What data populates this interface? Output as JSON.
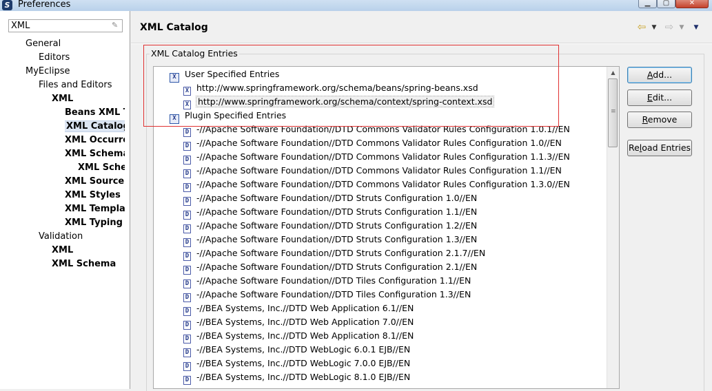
{
  "window": {
    "title": "Preferences",
    "app_icon_letter": "S"
  },
  "filter": {
    "value": "XML"
  },
  "tree": [
    {
      "label": "General",
      "indent": 1,
      "bold": false,
      "selected": false
    },
    {
      "label": "Editors",
      "indent": 2,
      "bold": false,
      "selected": false
    },
    {
      "label": "MyEclipse",
      "indent": 1,
      "bold": false,
      "selected": false
    },
    {
      "label": "Files and Editors",
      "indent": 2,
      "bold": false,
      "selected": false
    },
    {
      "label": "XML",
      "indent": 3,
      "bold": true,
      "selected": false
    },
    {
      "label": "Beans XML Te",
      "indent": 4,
      "bold": true,
      "selected": false
    },
    {
      "label": "XML Catalog",
      "indent": 4,
      "bold": true,
      "selected": true
    },
    {
      "label": "XML Occurren",
      "indent": 4,
      "bold": true,
      "selected": false
    },
    {
      "label": "XML Schema",
      "indent": 4,
      "bold": true,
      "selected": false
    },
    {
      "label": "XML Schen",
      "indent": 5,
      "bold": true,
      "selected": false
    },
    {
      "label": "XML Source",
      "indent": 4,
      "bold": true,
      "selected": false
    },
    {
      "label": "XML Styles",
      "indent": 4,
      "bold": true,
      "selected": false
    },
    {
      "label": "XML Template",
      "indent": 4,
      "bold": true,
      "selected": false
    },
    {
      "label": "XML Typing",
      "indent": 4,
      "bold": true,
      "selected": false
    },
    {
      "label": "Validation",
      "indent": 2,
      "bold": false,
      "selected": false
    },
    {
      "label": "XML",
      "indent": 3,
      "bold": true,
      "selected": false
    },
    {
      "label": "XML Schema",
      "indent": 3,
      "bold": true,
      "selected": false
    }
  ],
  "page": {
    "title": "XML Catalog",
    "group_label": "XML Catalog Entries"
  },
  "entries": [
    {
      "label": "User Specified Entries",
      "level": 0,
      "kind": "category",
      "icon": "X",
      "selected": false
    },
    {
      "label": "http://www.springframework.org/schema/beans/spring-beans.xsd",
      "level": 1,
      "kind": "xsd",
      "icon": "X",
      "selected": false
    },
    {
      "label": "http://www.springframework.org/schema/context/spring-context.xsd",
      "level": 1,
      "kind": "xsd",
      "icon": "X",
      "selected": true
    },
    {
      "label": "Plugin Specified Entries",
      "level": 0,
      "kind": "category",
      "icon": "X",
      "selected": false
    },
    {
      "label": "-//Apache Software Foundation//DTD Commons Validator Rules Configuration 1.0.1//EN",
      "level": 1,
      "kind": "dtd",
      "icon": "D",
      "selected": false
    },
    {
      "label": "-//Apache Software Foundation//DTD Commons Validator Rules Configuration 1.0//EN",
      "level": 1,
      "kind": "dtd",
      "icon": "D",
      "selected": false
    },
    {
      "label": "-//Apache Software Foundation//DTD Commons Validator Rules Configuration 1.1.3//EN",
      "level": 1,
      "kind": "dtd",
      "icon": "D",
      "selected": false
    },
    {
      "label": "-//Apache Software Foundation//DTD Commons Validator Rules Configuration 1.1//EN",
      "level": 1,
      "kind": "dtd",
      "icon": "D",
      "selected": false
    },
    {
      "label": "-//Apache Software Foundation//DTD Commons Validator Rules Configuration 1.3.0//EN",
      "level": 1,
      "kind": "dtd",
      "icon": "D",
      "selected": false
    },
    {
      "label": "-//Apache Software Foundation//DTD Struts Configuration 1.0//EN",
      "level": 1,
      "kind": "dtd",
      "icon": "D",
      "selected": false
    },
    {
      "label": "-//Apache Software Foundation//DTD Struts Configuration 1.1//EN",
      "level": 1,
      "kind": "dtd",
      "icon": "D",
      "selected": false
    },
    {
      "label": "-//Apache Software Foundation//DTD Struts Configuration 1.2//EN",
      "level": 1,
      "kind": "dtd",
      "icon": "D",
      "selected": false
    },
    {
      "label": "-//Apache Software Foundation//DTD Struts Configuration 1.3//EN",
      "level": 1,
      "kind": "dtd",
      "icon": "D",
      "selected": false
    },
    {
      "label": "-//Apache Software Foundation//DTD Struts Configuration 2.1.7//EN",
      "level": 1,
      "kind": "dtd",
      "icon": "D",
      "selected": false
    },
    {
      "label": "-//Apache Software Foundation//DTD Struts Configuration 2.1//EN",
      "level": 1,
      "kind": "dtd",
      "icon": "D",
      "selected": false
    },
    {
      "label": "-//Apache Software Foundation//DTD Tiles Configuration 1.1//EN",
      "level": 1,
      "kind": "dtd",
      "icon": "D",
      "selected": false
    },
    {
      "label": "-//Apache Software Foundation//DTD Tiles Configuration 1.3//EN",
      "level": 1,
      "kind": "dtd",
      "icon": "D",
      "selected": false
    },
    {
      "label": "-//BEA Systems, Inc.//DTD Web Application 6.1//EN",
      "level": 1,
      "kind": "dtd",
      "icon": "D",
      "selected": false
    },
    {
      "label": "-//BEA Systems, Inc.//DTD Web Application 7.0//EN",
      "level": 1,
      "kind": "dtd",
      "icon": "D",
      "selected": false
    },
    {
      "label": "-//BEA Systems, Inc.//DTD Web Application 8.1//EN",
      "level": 1,
      "kind": "dtd",
      "icon": "D",
      "selected": false
    },
    {
      "label": "-//BEA Systems, Inc.//DTD WebLogic 6.0.1 EJB//EN",
      "level": 1,
      "kind": "dtd",
      "icon": "D",
      "selected": false
    },
    {
      "label": "-//BEA Systems, Inc.//DTD WebLogic 7.0.0 EJB//EN",
      "level": 1,
      "kind": "dtd",
      "icon": "D",
      "selected": false
    },
    {
      "label": "-//BEA Systems, Inc.//DTD WebLogic 8.1.0 EJB//EN",
      "level": 1,
      "kind": "dtd",
      "icon": "D",
      "selected": false
    }
  ],
  "buttons": {
    "add": {
      "mnemonic": "A",
      "rest": "dd..."
    },
    "edit": {
      "mnemonic": "E",
      "rest": "dit..."
    },
    "remove": {
      "mnemonic": "R",
      "rest": "emove"
    },
    "reload": {
      "pre": "Re",
      "mnemonic": "l",
      "rest": "oad Entries"
    }
  },
  "icons": {
    "back": "back-arrow-icon",
    "forward": "forward-arrow-icon",
    "menu": "view-menu-icon"
  },
  "colors": {
    "highlight_annotation": "#e03030",
    "selection": "#dde6f3",
    "icon_blue": "#2c56a8"
  }
}
